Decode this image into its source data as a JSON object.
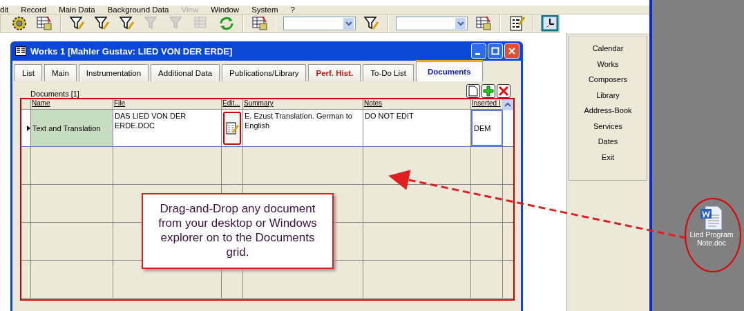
{
  "menu": [
    {
      "label": "dit",
      "disabled": false
    },
    {
      "label": "Record",
      "disabled": false
    },
    {
      "label": "Main Data",
      "disabled": false
    },
    {
      "label": "Background Data",
      "disabled": false
    },
    {
      "label": "View",
      "disabled": true
    },
    {
      "label": "Window",
      "disabled": false
    },
    {
      "label": "System",
      "disabled": false
    },
    {
      "label": "?",
      "disabled": false
    }
  ],
  "toolbar": [
    {
      "kind": "button",
      "disabled": false
    },
    {
      "kind": "button",
      "disabled": false
    },
    {
      "kind": "separator"
    },
    {
      "kind": "button",
      "disabled": false
    },
    {
      "kind": "button",
      "disabled": false
    },
    {
      "kind": "button",
      "disabled": false
    },
    {
      "kind": "button",
      "disabled": true
    },
    {
      "kind": "button",
      "disabled": true
    },
    {
      "kind": "button",
      "disabled": true
    },
    {
      "kind": "button",
      "disabled": false
    },
    {
      "kind": "separator"
    },
    {
      "kind": "button",
      "disabled": false
    },
    {
      "kind": "separator"
    },
    {
      "kind": "combo"
    },
    {
      "kind": "button",
      "disabled": false
    },
    {
      "kind": "separator"
    },
    {
      "kind": "combo"
    },
    {
      "kind": "button",
      "disabled": false
    },
    {
      "kind": "separator"
    },
    {
      "kind": "button",
      "disabled": false
    },
    {
      "kind": "separator"
    },
    {
      "kind": "button",
      "disabled": false
    }
  ],
  "window": {
    "title": "Works  1 [Mahler Gustav: LIED VON DER ERDE]"
  },
  "tabs": [
    {
      "label": "List",
      "selected": false,
      "highlighted": false
    },
    {
      "label": "Main",
      "selected": false,
      "highlighted": false
    },
    {
      "label": "Instrumentation",
      "selected": false,
      "highlighted": false
    },
    {
      "label": "Additional Data",
      "selected": false,
      "highlighted": false
    },
    {
      "label": "Publications/Library",
      "selected": false,
      "highlighted": false
    },
    {
      "label": "Perf. Hist.",
      "selected": false,
      "highlighted": true
    },
    {
      "label": "To-Do List",
      "selected": false,
      "highlighted": false
    },
    {
      "label": "Documents",
      "selected": true,
      "highlighted": false
    }
  ],
  "documents": {
    "group_title": "Documents  [1]",
    "columns": [
      "Name",
      "File",
      "Edit...",
      "Summary",
      "Notes",
      "Inserted I"
    ],
    "rows": [
      {
        "selected": true,
        "name": "Text and Translation",
        "file": "DAS LIED VON DER ERDE.DOC",
        "summary": "E. Ezust Translation. German to English",
        "notes": "DO NOT EDIT",
        "inserted": "DEM"
      }
    ]
  },
  "side_menu": [
    "Calendar",
    "Works",
    "Composers",
    "Library",
    "Address-Book",
    "Services",
    "Dates",
    "Exit"
  ],
  "desktop_icon": {
    "label": "Lied Program Note.doc"
  },
  "callout": "Drag-and-Drop any document from your desktop or Windows explorer on to the Documents grid."
}
